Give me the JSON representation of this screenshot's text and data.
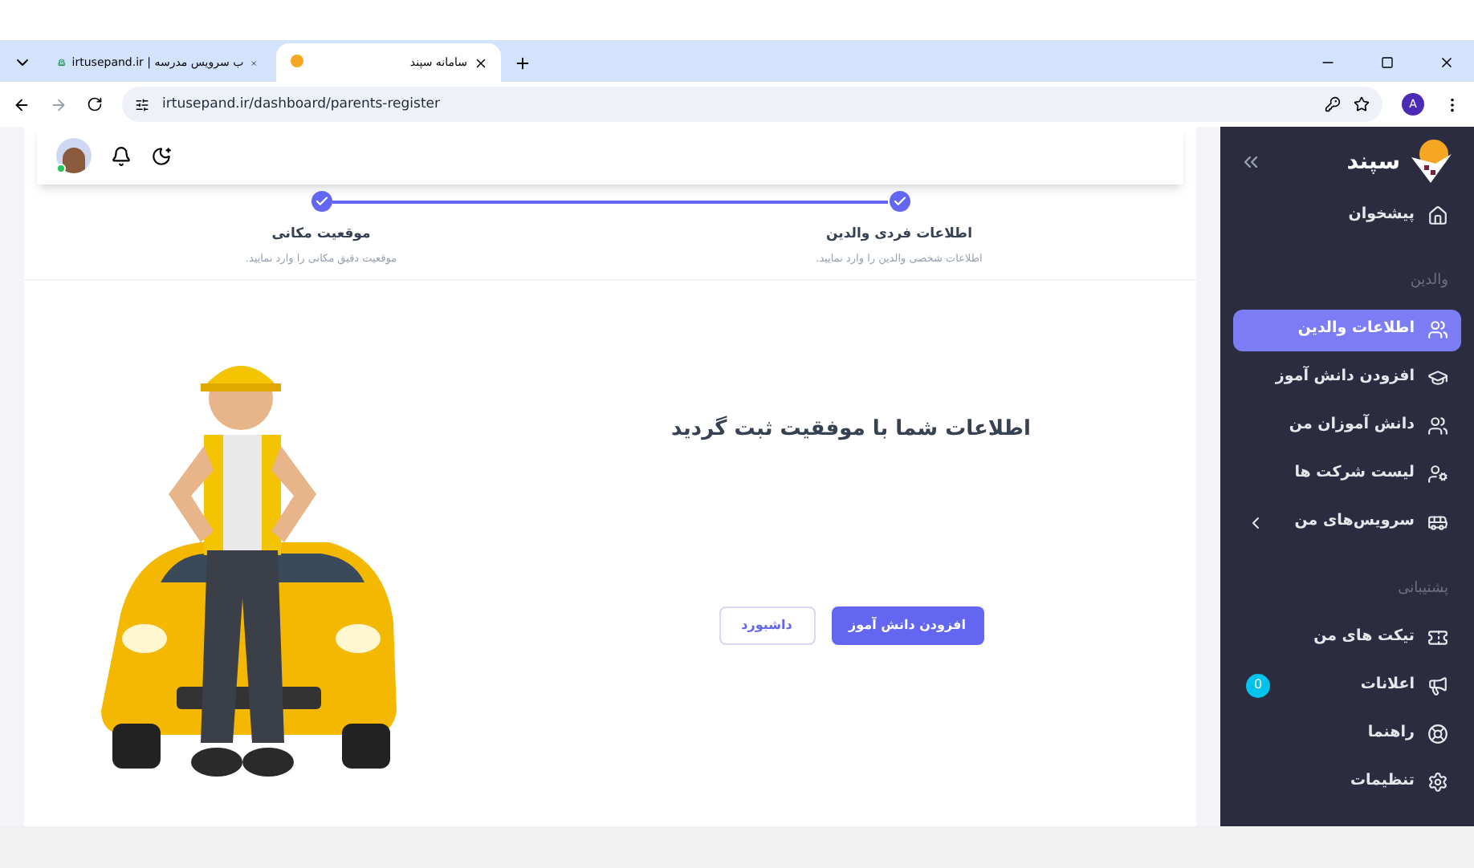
{
  "browser": {
    "tabs": [
      {
        "title": "سامانه سپند",
        "selected": true
      },
      {
        "title": "ب سرویس مدرسه | irtusepand.ir",
        "selected": false
      }
    ],
    "url": "irtusepand.ir/dashboard/parents-register",
    "profile_initial": "A"
  },
  "sidebar": {
    "brand": "سپند",
    "items": [
      {
        "kind": "item",
        "label": "پیشخوان",
        "selected": false
      },
      {
        "kind": "section",
        "label": "والدین"
      },
      {
        "kind": "item",
        "label": "اطلاعات والدین",
        "selected": true
      },
      {
        "kind": "item",
        "label": "افزودن دانش آموز",
        "selected": false
      },
      {
        "kind": "item",
        "label": "دانش آموزان من",
        "selected": false
      },
      {
        "kind": "item",
        "label": "لیست شرکت ها",
        "selected": false
      },
      {
        "kind": "item",
        "label": "سرویس‌های من",
        "selected": false,
        "expanded": false
      },
      {
        "kind": "section",
        "label": "پشتیبانی"
      },
      {
        "kind": "item",
        "label": "تیکت های من",
        "selected": false
      },
      {
        "kind": "item",
        "label": "اعلانات",
        "selected": false,
        "badge": "0"
      },
      {
        "kind": "item",
        "label": "راهنما",
        "selected": false
      },
      {
        "kind": "item",
        "label": "تنظیمات",
        "selected": false
      }
    ]
  },
  "header": {
    "online": true
  },
  "steps": [
    {
      "title": "اطلاعات فردی والدین",
      "subtitle": "اطلاعات شخصی والدین را وارد نمایید.",
      "done": true
    },
    {
      "title": "موقعیت مکانی",
      "subtitle": "موقعیت دقیق مکانی را وارد نمایید.",
      "done": true
    }
  ],
  "message": "اطلاعات شما با موفقیت ثبت گردید",
  "buttons": [
    {
      "kind": "primary",
      "label": "افزودن دانش آموز"
    },
    {
      "kind": "outline",
      "label": "داشبورد"
    }
  ]
}
